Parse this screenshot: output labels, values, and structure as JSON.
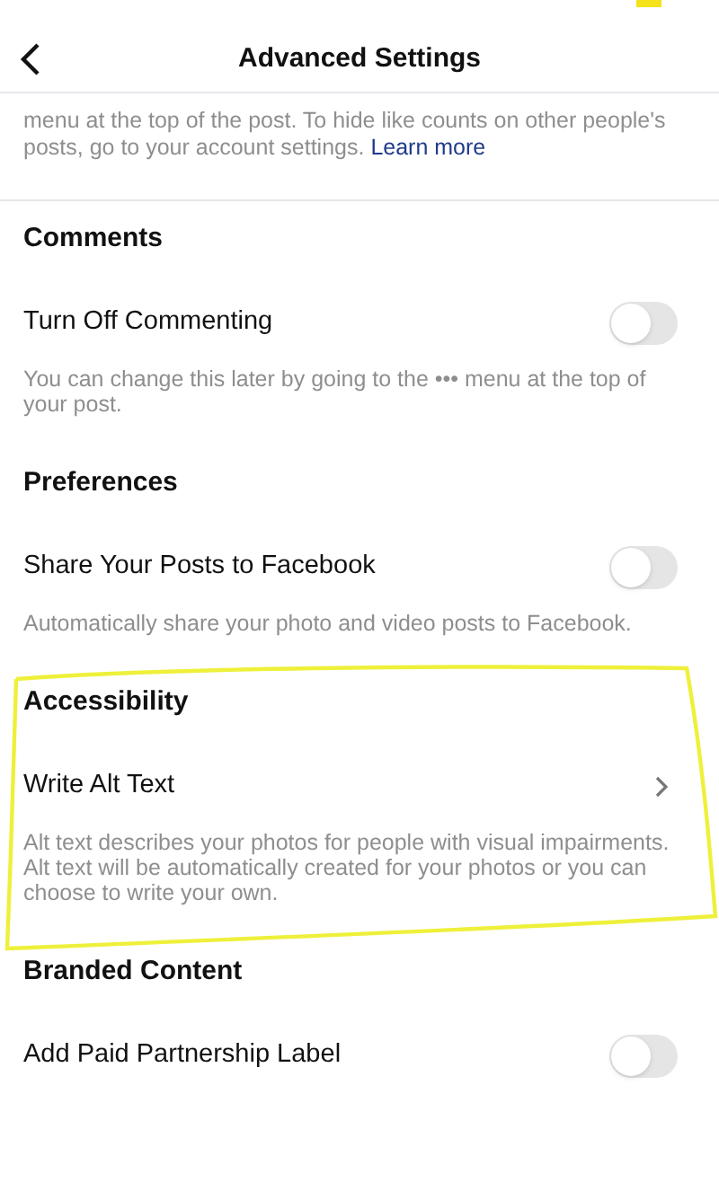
{
  "header": {
    "title": "Advanced Settings"
  },
  "intro": {
    "text": "menu at the top of the post. To hide like counts on other people's posts, go to your account settings.",
    "link": "Learn more"
  },
  "sections": [
    {
      "title": "Comments",
      "row": {
        "kind": "toggle",
        "label": "Turn Off Commenting",
        "on": false
      },
      "description": "You can change this later by going to the ••• menu at the top of your post."
    },
    {
      "title": "Preferences",
      "row": {
        "kind": "toggle",
        "label": "Share Your Posts to Facebook",
        "on": false
      },
      "description": "Automatically share your photo and video posts to Facebook."
    },
    {
      "title": "Accessibility",
      "row": {
        "kind": "link",
        "label": "Write Alt Text"
      },
      "description": "Alt text describes your photos for people with visual impairments. Alt text will be automatically created for your photos or you can choose to write your own."
    },
    {
      "title": "Branded Content",
      "row": {
        "kind": "toggle",
        "label": "Add Paid Partnership Label",
        "on": false
      }
    }
  ]
}
